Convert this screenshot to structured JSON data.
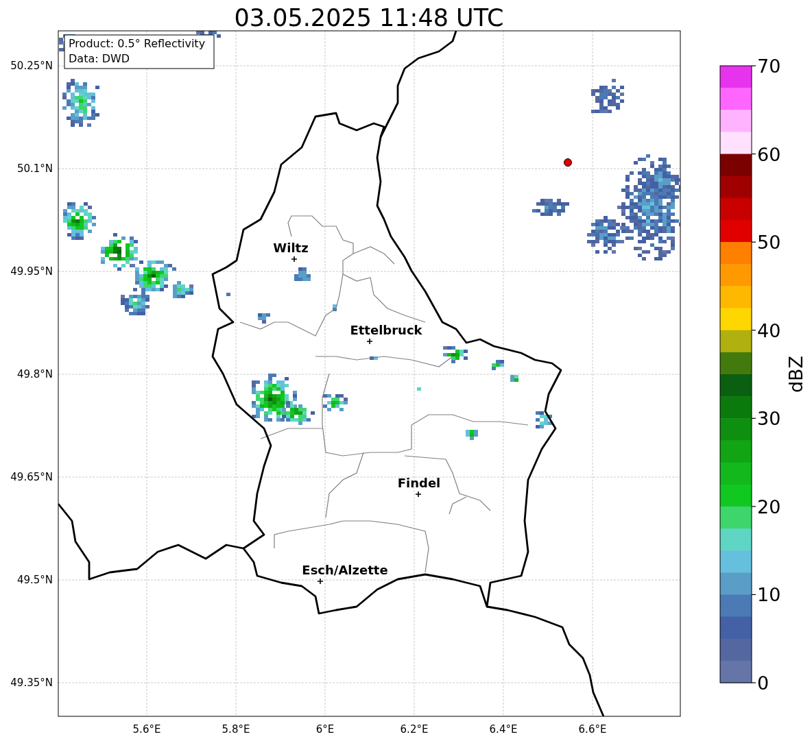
{
  "title": "03.05.2025 11:48 UTC",
  "info_box": [
    "Product: 0.5° Reflectivity",
    "Data: DWD"
  ],
  "map": {
    "x_ticks": [
      "5.6°E",
      "5.8°E",
      "6°E",
      "6.2°E",
      "6.4°E",
      "6.6°E"
    ],
    "y_ticks": [
      "50.25°N",
      "50.1°N",
      "49.95°N",
      "49.8°N",
      "49.65°N",
      "49.5°N",
      "49.35°N"
    ],
    "cities": [
      "Wiltz",
      "Ettelbruck",
      "Findel",
      "Esch/Alzette"
    ]
  },
  "colorbar": {
    "label": "dBZ",
    "ticks": [
      "70",
      "60",
      "50",
      "40",
      "30",
      "20",
      "10",
      "0"
    ],
    "bands": [
      {
        "color": "#e833ee"
      },
      {
        "color": "#ff66ff"
      },
      {
        "color": "#ffb3ff"
      },
      {
        "color": "#ffe0ff"
      },
      {
        "color": "#7b0000"
      },
      {
        "color": "#a00000"
      },
      {
        "color": "#c80000"
      },
      {
        "color": "#e00000"
      },
      {
        "color": "#ff7f00"
      },
      {
        "color": "#ff9900"
      },
      {
        "color": "#ffb800"
      },
      {
        "color": "#ffd700"
      },
      {
        "color": "#b0b010"
      },
      {
        "color": "#437a0e"
      },
      {
        "color": "#0a5f10"
      },
      {
        "color": "#0b7a0c"
      },
      {
        "color": "#0e8f10"
      },
      {
        "color": "#11a514"
      },
      {
        "color": "#12b81c"
      },
      {
        "color": "#10c820"
      },
      {
        "color": "#3ed66c"
      },
      {
        "color": "#5fd6c4"
      },
      {
        "color": "#64c0dc"
      },
      {
        "color": "#5a9ec8"
      },
      {
        "color": "#4b7ab5"
      },
      {
        "color": "#4361a4"
      },
      {
        "color": "#5467a0"
      },
      {
        "color": "#6575a8"
      }
    ]
  }
}
